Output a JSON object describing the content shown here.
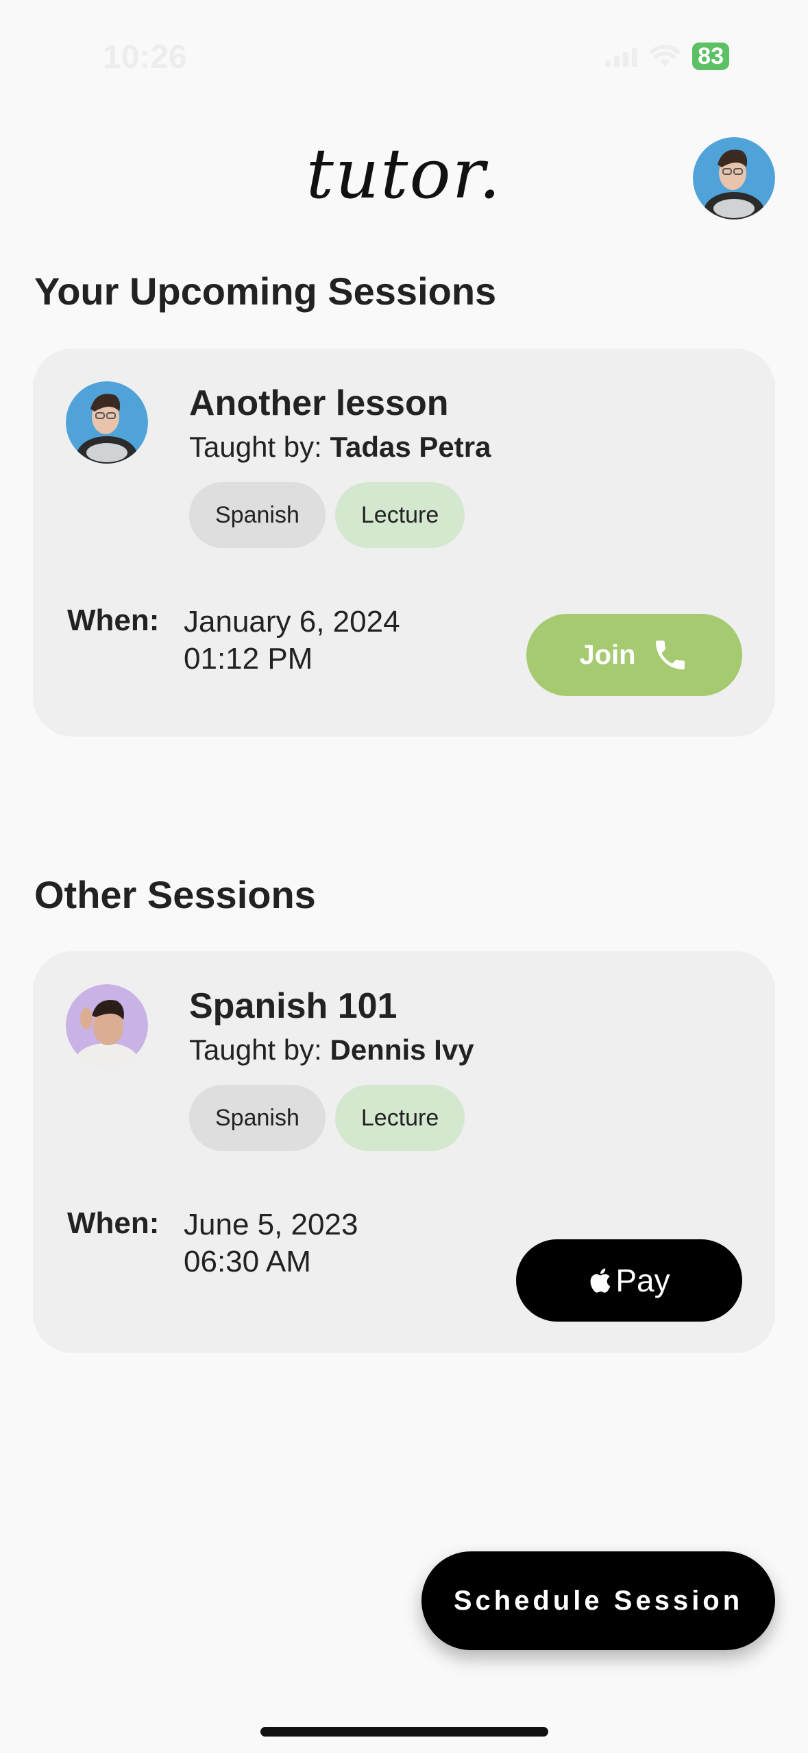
{
  "status_bar": {
    "time": "10:26",
    "battery": "83"
  },
  "header": {
    "logo": "tutor."
  },
  "upcoming": {
    "title": "Your Upcoming Sessions",
    "session": {
      "title": "Another lesson",
      "taught_by_label": "Taught by:",
      "tutor": "Tadas Petra",
      "tags": [
        "Spanish",
        "Lecture"
      ],
      "when_label": "When:",
      "date": "January 6, 2024",
      "time": "01:12 PM",
      "action_label": "Join",
      "action_icon": "phone-icon"
    }
  },
  "other": {
    "title": "Other Sessions",
    "session": {
      "title": "Spanish 101",
      "taught_by_label": "Taught by:",
      "tutor": "Dennis Ivy",
      "tags": [
        "Spanish",
        "Lecture"
      ],
      "when_label": "When:",
      "date": "June 5, 2023",
      "time": "06:30 AM",
      "action_label": "Pay",
      "action_icon": "apple-icon"
    }
  },
  "fab": {
    "label": "Schedule Session"
  },
  "colors": {
    "join": "#a5ca70",
    "tag_green": "#d3e8cf",
    "tag_gray": "#dedede",
    "card": "#efefef"
  }
}
